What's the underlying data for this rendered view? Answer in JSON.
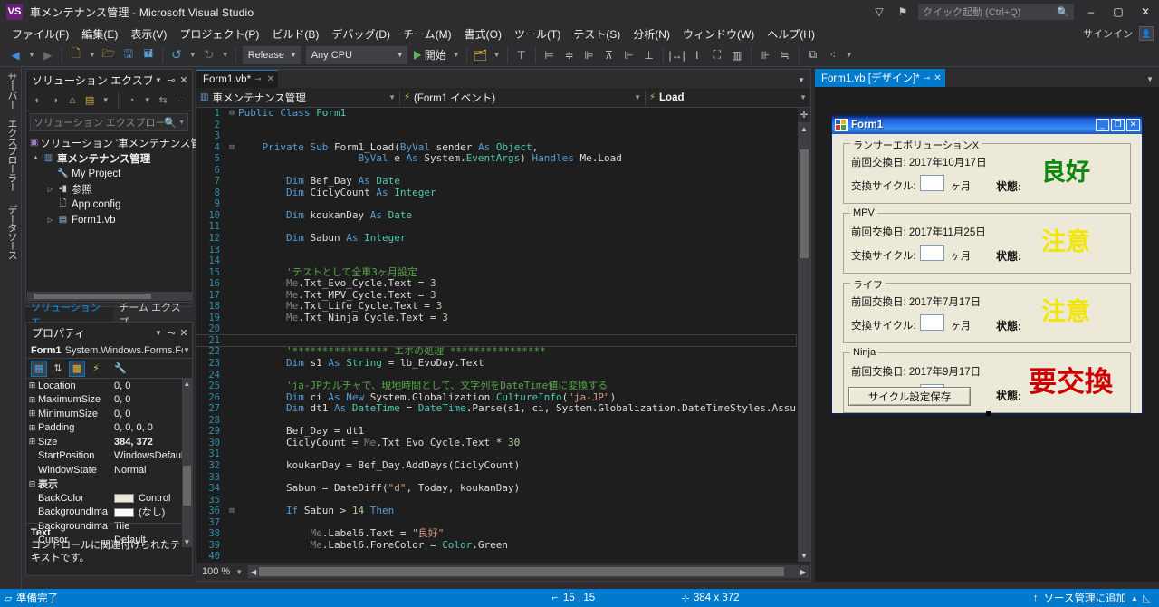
{
  "window": {
    "title": "車メンテナンス管理 - Microsoft Visual Studio",
    "logo_text": "VS",
    "minimize": "–",
    "maximize": "▢",
    "close": "✕",
    "signin_label": "サインイン",
    "feedback_icon": "▽",
    "notify_icon": "⚑"
  },
  "quick_launch": {
    "placeholder": "クイック起動 (Ctrl+Q)",
    "icon": "search-icon"
  },
  "menu": {
    "items": [
      "ファイル(F)",
      "編集(E)",
      "表示(V)",
      "プロジェクト(P)",
      "ビルド(B)",
      "デバッグ(D)",
      "チーム(M)",
      "書式(O)",
      "ツール(T)",
      "テスト(S)",
      "分析(N)",
      "ウィンドウ(W)",
      "ヘルプ(H)"
    ]
  },
  "toolbar": {
    "back_icon": "◀",
    "forward_icon": "▶",
    "new_icon": "🗋",
    "open_icon": "🗁",
    "save_icon": "🖫",
    "saveall_icon": "🖬",
    "undo_icon": "↺",
    "redo_icon": "↻",
    "configuration": "Release",
    "platform": "Any CPU",
    "start_label": "開始",
    "find_icon": "🔍"
  },
  "vertical_tabs": [
    "サーバー エクスプローラー",
    "データソース"
  ],
  "solution_explorer": {
    "title": "ソリューション エクスプローラー",
    "search_placeholder": "ソリューション エクスプローラー の検",
    "toolbar_icons": [
      "back-icon",
      "forward-icon",
      "home-icon",
      "properties-icon",
      "pending-changes-icon",
      "sync-icon"
    ],
    "tree": [
      {
        "indent": 0,
        "arrow": "",
        "icon": "solution-icon",
        "label": "ソリューション '車メンテナンス管理' (",
        "bold": false
      },
      {
        "indent": 0,
        "arrow": "▲",
        "icon": "vb-project-icon",
        "label": "車メンテナンス管理",
        "bold": true
      },
      {
        "indent": 1,
        "arrow": "",
        "icon": "wrench-icon",
        "label": "My Project",
        "bold": false
      },
      {
        "indent": 1,
        "arrow": "▷",
        "icon": "references-icon",
        "label": "参照",
        "bold": false
      },
      {
        "indent": 1,
        "arrow": "",
        "icon": "config-icon",
        "label": "App.config",
        "bold": false
      },
      {
        "indent": 1,
        "arrow": "▷",
        "icon": "form-icon",
        "label": "Form1.vb",
        "bold": false
      }
    ]
  },
  "panel_tabs": [
    {
      "label": "ソリューション エ…",
      "active": true
    },
    {
      "label": "チーム エクスプ…",
      "active": false
    }
  ],
  "properties": {
    "title": "プロパティ",
    "object_name": "Form1",
    "object_type": "System.Windows.Forms.For",
    "toolbar_icons": [
      "categorized-icon",
      "alphabetical-icon",
      "properties-icon",
      "events-icon",
      "property-pages-icon"
    ],
    "rows": [
      {
        "exp": "⊞",
        "name": "Location",
        "value": "0, 0",
        "bold": false,
        "swatch": ""
      },
      {
        "exp": "⊞",
        "name": "MaximumSize",
        "value": "0, 0",
        "bold": false,
        "swatch": ""
      },
      {
        "exp": "⊞",
        "name": "MinimumSize",
        "value": "0, 0",
        "bold": false,
        "swatch": ""
      },
      {
        "exp": "⊞",
        "name": "Padding",
        "value": "0, 0, 0, 0",
        "bold": false,
        "swatch": ""
      },
      {
        "exp": "⊞",
        "name": "Size",
        "value": "384, 372",
        "bold": true,
        "swatch": ""
      },
      {
        "exp": "",
        "name": "StartPosition",
        "value": "WindowsDefault",
        "bold": false,
        "swatch": ""
      },
      {
        "exp": "",
        "name": "WindowState",
        "value": "Normal",
        "bold": false,
        "swatch": ""
      },
      {
        "exp": "⊟",
        "name": "表示",
        "value": "",
        "bold": true,
        "swatch": ""
      },
      {
        "exp": "",
        "name": "BackColor",
        "value": "Control",
        "bold": false,
        "swatch": "#ece9d8"
      },
      {
        "exp": "",
        "name": "BackgroundIma",
        "value": "(なし)",
        "bold": false,
        "swatch": "#ffffff"
      },
      {
        "exp": "",
        "name": "BackgroundIma",
        "value": "Tile",
        "bold": false,
        "swatch": ""
      },
      {
        "exp": "",
        "name": "Cursor",
        "value": "Default",
        "bold": false,
        "swatch": ""
      }
    ],
    "description_title": "Text",
    "description_body": "コントロールに関連付けられたテキストです。"
  },
  "editor": {
    "tab_label": "Form1.vb*",
    "tab_pin": "⊸",
    "tab_close": "✕",
    "nav_class": "車メンテナンス管理",
    "nav_member": "(Form1 イベント)",
    "nav_event": "Load",
    "zoom": "100 %",
    "lines": [
      {
        "n": 1,
        "gut": "⊟",
        "tokens": [
          [
            "k",
            "Public "
          ],
          [
            "k",
            "Class "
          ],
          [
            "t",
            "Form1"
          ]
        ],
        "indent": 0
      },
      {
        "n": 2,
        "gut": "",
        "tokens": [],
        "indent": 0
      },
      {
        "n": 3,
        "gut": "",
        "tokens": [],
        "indent": 0
      },
      {
        "n": 4,
        "gut": "⊟",
        "tokens": [
          [
            "k",
            "Private "
          ],
          [
            "k",
            "Sub "
          ],
          [
            "w",
            "Form1_Load("
          ],
          [
            "k",
            "ByVal "
          ],
          [
            "w",
            "sender "
          ],
          [
            "k",
            "As "
          ],
          [
            "t",
            "Object"
          ],
          [
            "w",
            ","
          ]
        ],
        "indent": 4
      },
      {
        "n": 5,
        "gut": "",
        "tokens": [
          [
            "k",
            "ByVal "
          ],
          [
            "w",
            "e "
          ],
          [
            "k",
            "As "
          ],
          [
            "w",
            "System."
          ],
          [
            "t",
            "EventArgs"
          ],
          [
            "w",
            ") "
          ],
          [
            "k",
            "Handles "
          ],
          [
            "w",
            "Me.Load"
          ]
        ],
        "indent": 20
      },
      {
        "n": 6,
        "gut": "",
        "tokens": [],
        "indent": 0
      },
      {
        "n": 7,
        "gut": "",
        "tokens": [
          [
            "k",
            "Dim "
          ],
          [
            "w",
            "Bef_Day "
          ],
          [
            "k",
            "As "
          ],
          [
            "t",
            "Date"
          ]
        ],
        "indent": 8
      },
      {
        "n": 8,
        "gut": "",
        "tokens": [
          [
            "k",
            "Dim "
          ],
          [
            "w",
            "CiclyCount "
          ],
          [
            "k",
            "As "
          ],
          [
            "t",
            "Integer"
          ]
        ],
        "indent": 8
      },
      {
        "n": 9,
        "gut": "",
        "tokens": [],
        "indent": 0
      },
      {
        "n": 10,
        "gut": "",
        "tokens": [
          [
            "k",
            "Dim "
          ],
          [
            "w",
            "koukanDay "
          ],
          [
            "k",
            "As "
          ],
          [
            "t",
            "Date"
          ]
        ],
        "indent": 8
      },
      {
        "n": 11,
        "gut": "",
        "tokens": [],
        "indent": 0
      },
      {
        "n": 12,
        "gut": "",
        "tokens": [
          [
            "k",
            "Dim "
          ],
          [
            "w",
            "Sabun "
          ],
          [
            "k",
            "As "
          ],
          [
            "t",
            "Integer"
          ]
        ],
        "indent": 8
      },
      {
        "n": 13,
        "gut": "",
        "tokens": [],
        "indent": 0
      },
      {
        "n": 14,
        "gut": "",
        "tokens": [],
        "indent": 0
      },
      {
        "n": 15,
        "gut": "",
        "tokens": [
          [
            "c",
            "'テストとして全車3ヶ月設定"
          ]
        ],
        "indent": 8
      },
      {
        "n": 16,
        "gut": "",
        "tokens": [
          [
            "me",
            "Me"
          ],
          [
            "w",
            ".Txt_Evo_Cycle.Text = "
          ],
          [
            "n",
            "3"
          ]
        ],
        "indent": 8
      },
      {
        "n": 17,
        "gut": "",
        "tokens": [
          [
            "me",
            "Me"
          ],
          [
            "w",
            ".Txt_MPV_Cycle.Text = "
          ],
          [
            "n",
            "3"
          ]
        ],
        "indent": 8
      },
      {
        "n": 18,
        "gut": "",
        "tokens": [
          [
            "me",
            "Me"
          ],
          [
            "w",
            ".Txt_Life_Cycle.Text = "
          ],
          [
            "n",
            "3"
          ]
        ],
        "indent": 8
      },
      {
        "n": 19,
        "gut": "",
        "tokens": [
          [
            "me",
            "Me"
          ],
          [
            "w",
            ".Txt_Ninja_Cycle.Text = "
          ],
          [
            "n",
            "3"
          ]
        ],
        "indent": 8
      },
      {
        "n": 20,
        "gut": "",
        "tokens": [],
        "indent": 0
      },
      {
        "n": 21,
        "gut": "",
        "tokens": [],
        "indent": 0,
        "current": true
      },
      {
        "n": 22,
        "gut": "",
        "tokens": [
          [
            "c",
            "'**************** エボの処理 ****************"
          ]
        ],
        "indent": 8
      },
      {
        "n": 23,
        "gut": "",
        "tokens": [
          [
            "k",
            "Dim "
          ],
          [
            "w",
            "s1 "
          ],
          [
            "k",
            "As "
          ],
          [
            "t",
            "String"
          ],
          [
            "w",
            " = lb_EvoDay.Text"
          ]
        ],
        "indent": 8
      },
      {
        "n": 24,
        "gut": "",
        "tokens": [],
        "indent": 0
      },
      {
        "n": 25,
        "gut": "",
        "tokens": [
          [
            "c",
            "'ja-JPカルチャで、現地時間として、文字列をDateTime値に変換する"
          ]
        ],
        "indent": 8
      },
      {
        "n": 26,
        "gut": "",
        "tokens": [
          [
            "k",
            "Dim "
          ],
          [
            "w",
            "ci "
          ],
          [
            "k",
            "As "
          ],
          [
            "k",
            "New "
          ],
          [
            "w",
            "System.Globalization."
          ],
          [
            "t",
            "CultureInfo"
          ],
          [
            "w",
            "("
          ],
          [
            "s",
            "\"ja-JP\""
          ],
          [
            "w",
            ")"
          ]
        ],
        "indent": 8
      },
      {
        "n": 27,
        "gut": "",
        "tokens": [
          [
            "k",
            "Dim "
          ],
          [
            "w",
            "dt1 "
          ],
          [
            "k",
            "As "
          ],
          [
            "t",
            "DateTime"
          ],
          [
            "w",
            " = "
          ],
          [
            "t",
            "DateTime"
          ],
          [
            "w",
            ".Parse(s1, ci, System.Globalization.DateTimeStyles.Assu"
          ]
        ],
        "indent": 8
      },
      {
        "n": 28,
        "gut": "",
        "tokens": [],
        "indent": 0
      },
      {
        "n": 29,
        "gut": "",
        "tokens": [
          [
            "w",
            "Bef_Day = dt1"
          ]
        ],
        "indent": 8
      },
      {
        "n": 30,
        "gut": "",
        "tokens": [
          [
            "w",
            "CiclyCount = "
          ],
          [
            "me",
            "Me"
          ],
          [
            "w",
            ".Txt_Evo_Cycle.Text * "
          ],
          [
            "n",
            "30"
          ]
        ],
        "indent": 8
      },
      {
        "n": 31,
        "gut": "",
        "tokens": [],
        "indent": 0
      },
      {
        "n": 32,
        "gut": "",
        "tokens": [
          [
            "w",
            "koukanDay = Bef_Day.AddDays(CiclyCount)"
          ]
        ],
        "indent": 8
      },
      {
        "n": 33,
        "gut": "",
        "tokens": [],
        "indent": 0
      },
      {
        "n": 34,
        "gut": "",
        "tokens": [
          [
            "w",
            "Sabun = DateDiff("
          ],
          [
            "s",
            "\"d\""
          ],
          [
            "w",
            ", Today, koukanDay)"
          ]
        ],
        "indent": 8
      },
      {
        "n": 35,
        "gut": "",
        "tokens": [],
        "indent": 0
      },
      {
        "n": 36,
        "gut": "⊟",
        "tokens": [
          [
            "k",
            "If "
          ],
          [
            "w",
            "Sabun > "
          ],
          [
            "n",
            "14 "
          ],
          [
            "k",
            "Then"
          ]
        ],
        "indent": 8
      },
      {
        "n": 37,
        "gut": "",
        "tokens": [],
        "indent": 0
      },
      {
        "n": 38,
        "gut": "",
        "tokens": [
          [
            "me",
            "Me"
          ],
          [
            "w",
            ".Label6.Text = "
          ],
          [
            "s",
            "\"良好\""
          ]
        ],
        "indent": 12
      },
      {
        "n": 39,
        "gut": "",
        "tokens": [
          [
            "me",
            "Me"
          ],
          [
            "w",
            ".Label6.ForeColor = "
          ],
          [
            "t",
            "Color"
          ],
          [
            "w",
            ".Green"
          ]
        ],
        "indent": 12
      },
      {
        "n": 40,
        "gut": "",
        "tokens": [],
        "indent": 0
      },
      {
        "n": 41,
        "gut": "",
        "tokens": [],
        "indent": 0
      }
    ]
  },
  "designer": {
    "tab_label": "Form1.vb [デザイン]*",
    "tab_pin": "⊸",
    "tab_close": "✕",
    "form": {
      "title": "Form1",
      "minimize": "_",
      "maximize": "❐",
      "close": "✕",
      "save_button": "サイクル設定保存",
      "label_date": "前回交換日:",
      "label_cycle": "交換サイクル:",
      "label_unit": "ヶ月",
      "label_state": "状態:",
      "groups": [
        {
          "name": "ランサーエボリューションX",
          "date": "2017年10月17日",
          "cycle": "",
          "state": "良好",
          "state_color": "#0c8a0c"
        },
        {
          "name": "MPV",
          "date": "2017年11月25日",
          "cycle": "",
          "state": "注意",
          "state_color": "#f2e600"
        },
        {
          "name": "ライフ",
          "date": "2017年7月17日",
          "cycle": "",
          "state": "注意",
          "state_color": "#f2e600"
        },
        {
          "name": "Ninja",
          "date": "2017年9月17日",
          "cycle": "",
          "state": "要交換",
          "state_color": "#cc0000"
        }
      ]
    }
  },
  "status_bar": {
    "ready": "準備完了",
    "ready_icon": "status-square-icon",
    "caret_position": "15 , 15",
    "caret_icon": "caret-icon",
    "size": "384 x 372",
    "size_icon": "size-icon",
    "source_control": "ソース管理に追加",
    "source_control_icon": "↑",
    "source_control_arrow": "▲"
  },
  "colors": {
    "accent": "#007acc",
    "chrome": "#2d2d30",
    "panel": "#252526",
    "editor_bg": "#1e1e1e"
  }
}
